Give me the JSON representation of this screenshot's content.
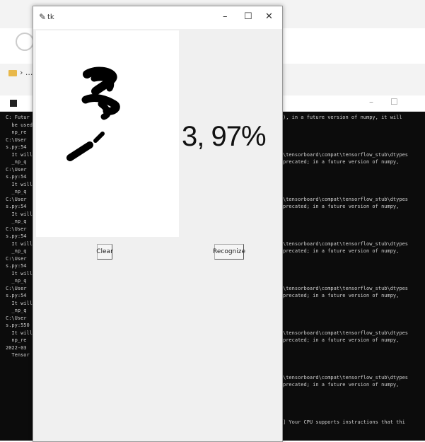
{
  "app": {
    "title": "tk",
    "feather_icon": "✎",
    "controls": {
      "minimize": "–",
      "maximize": "☐",
      "close": "✕"
    },
    "result_text": "3, 97%",
    "buttons": {
      "clear": "Clear",
      "recognize": "Recognize"
    }
  },
  "explorer": {
    "crumb": "› ..."
  },
  "terminal": {
    "controls": {
      "minimize": "–",
      "maximize": "☐"
    },
    "left_lines": [
      "C: Futur",
      "  be used",
      "  np_re",
      "C:\\User",
      "s.py:54",
      "  It will",
      "  _np_q",
      "C:\\User",
      "s.py:54",
      "  It will",
      "  _np_q",
      "C:\\User",
      "s.py:54",
      "  It will",
      "  _np_q",
      "C:\\User",
      "s.py:54",
      "  It will",
      "  _np_q",
      "C:\\User",
      "s.py:54",
      "  It will",
      "  _np_q",
      "C:\\User",
      "s.py:54",
      "  It will",
      "  _np_q",
      "C:\\User",
      "s.py:550",
      "  It will",
      "  np_re",
      "2022-03",
      "  Tensor"
    ],
    "right_lines": [
      "), in a future version of numpy, it will",
      "",
      "",
      "",
      "",
      "\\tensorboard\\compat\\tensorflow_stub\\dtypes",
      "precated; in a future version of numpy,",
      "",
      "",
      "",
      "",
      "\\tensorboard\\compat\\tensorflow_stub\\dtypes",
      "precated; in a future version of numpy,",
      "",
      "",
      "",
      "",
      "\\tensorboard\\compat\\tensorflow_stub\\dtypes",
      "precated; in a future version of numpy,",
      "",
      "",
      "",
      "",
      "\\tensorboard\\compat\\tensorflow_stub\\dtypes",
      "precated; in a future version of numpy,",
      "",
      "",
      "",
      "",
      "\\tensorboard\\compat\\tensorflow_stub\\dtypes",
      "precated; in a future version of numpy,",
      "",
      "",
      "",
      "",
      "\\tensorboard\\compat\\tensorflow_stub\\dtypes",
      "precated; in a future version of numpy,",
      "",
      "",
      "",
      "",
      "] Your CPU supports instructions that thi"
    ]
  }
}
